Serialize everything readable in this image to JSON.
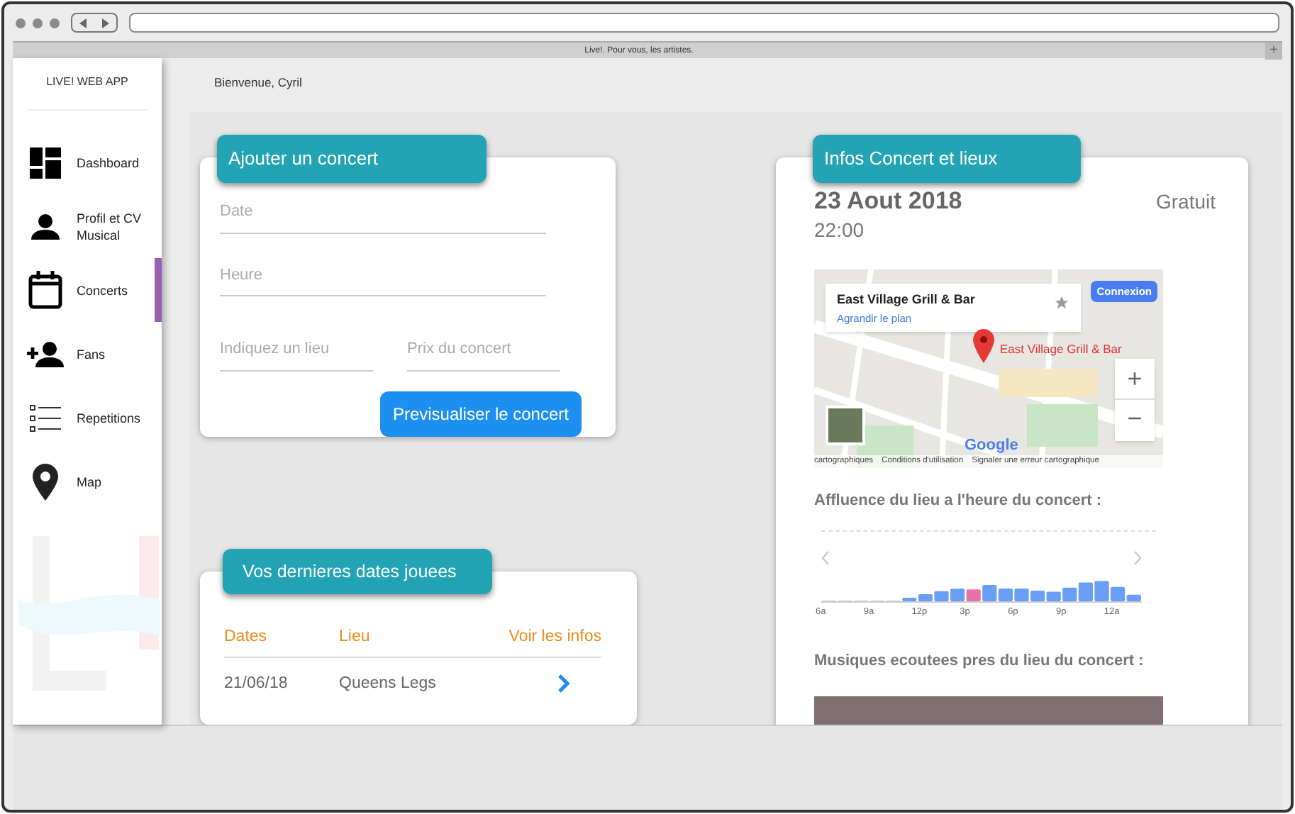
{
  "browser": {
    "tab_title": "Live!. Pour vous, les artistes.",
    "new_tab": "+"
  },
  "sidebar": {
    "title": "LIVE! WEB APP",
    "items": [
      {
        "label": "Dashboard",
        "kind": "dashboard",
        "selected": false
      },
      {
        "label": "Profil et CV Musical",
        "kind": "person",
        "selected": false
      },
      {
        "label": "Concerts",
        "kind": "calendar",
        "selected": true
      },
      {
        "label": "Fans",
        "kind": "add-person",
        "selected": false
      },
      {
        "label": "Repetitions",
        "kind": "list",
        "selected": false
      },
      {
        "label": "Map",
        "kind": "pin",
        "selected": false
      }
    ]
  },
  "greeting": "Bienvenue, Cyril",
  "add_concert": {
    "title": "Ajouter un concert",
    "fields": [
      {
        "placeholder": "Date"
      },
      {
        "placeholder": "Heure"
      },
      {
        "placeholder": "Indiquez un lieu"
      },
      {
        "placeholder": "Prix du concert"
      }
    ],
    "button": "Previsualiser le concert"
  },
  "recent_dates": {
    "title": "Vos dernieres dates jouees",
    "columns": [
      "Dates",
      "Lieu",
      "Voir les infos"
    ],
    "rows": [
      {
        "date": "21/06/18",
        "venue": "Queens Legs"
      }
    ]
  },
  "concert_info": {
    "title": "Infos Concert et lieux",
    "date": "23 Aout 2018",
    "time": "22:00",
    "price": "Gratuit",
    "map": {
      "place_name": "East Village Grill & Bar",
      "enlarge_link": "Agrandir le plan",
      "sign_in": "Connexion",
      "marker_label": "East Village Grill & Bar",
      "zoom_in": "+",
      "zoom_out": "−",
      "logo": "Google",
      "footer": [
        "cartographiques",
        "Conditions d'utilisation",
        "Signaler une erreur cartographique"
      ]
    },
    "affluence": {
      "title": "Affluence du lieu a l'heure du concert :",
      "hour_labels": [
        "6a",
        "9a",
        "12p",
        "3p",
        "6p",
        "9p",
        "12a"
      ]
    },
    "music_title": "Musiques ecoutees pres du lieu du concert :"
  }
}
